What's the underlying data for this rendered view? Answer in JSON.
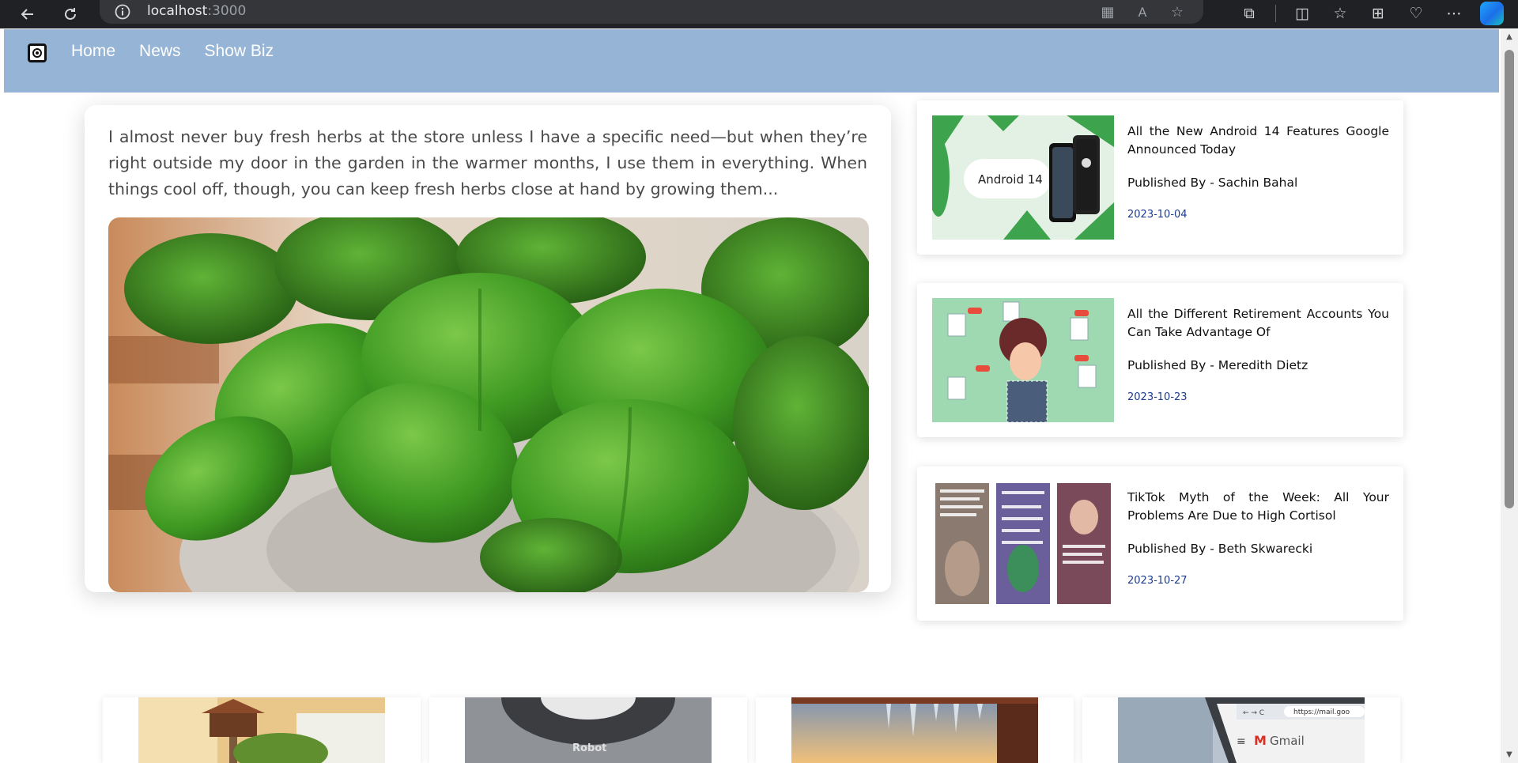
{
  "browser": {
    "url_host": "localhost",
    "url_port": ":3000"
  },
  "nav": {
    "links": [
      "Home",
      "News",
      "Show Biz"
    ]
  },
  "featured": {
    "excerpt": "I almost never buy fresh herbs at the store unless I have a specific need—but when they’re right outside my door in the garden in the warmer months, I use them in everything. When things cool off, though, you can keep fresh herbs close at hand by growing them...",
    "image_label": "basil plant photo"
  },
  "side_articles": [
    {
      "title": "All the New Android 14 Features Google Announced Today",
      "author": "Published By - Sachin Bahal",
      "date": "2023-10-04",
      "thumb_text": "Android 14"
    },
    {
      "title": "All the Different Retirement Accounts You Can Take Advantage Of",
      "author": "Published By - Meredith Dietz",
      "date": "2023-10-23",
      "thumb_text": ""
    },
    {
      "title": "TikTok Myth of the Week: All Your Problems Are Due to High Cortisol",
      "author": "Published By - Beth Skwarecki",
      "date": "2023-10-27",
      "thumb_text": ""
    }
  ],
  "bottom_cards": [
    {
      "thumb": "garden birdhouse"
    },
    {
      "thumb": "robot vacuum",
      "label": "Robot"
    },
    {
      "thumb": "icicles sunset"
    },
    {
      "thumb": "gmail browser",
      "label": "Gmail",
      "url": "https://mail.goo"
    }
  ],
  "colors": {
    "navbar": "#96b5d6",
    "date_text": "#1d3b8a",
    "chrome": "#202124"
  }
}
